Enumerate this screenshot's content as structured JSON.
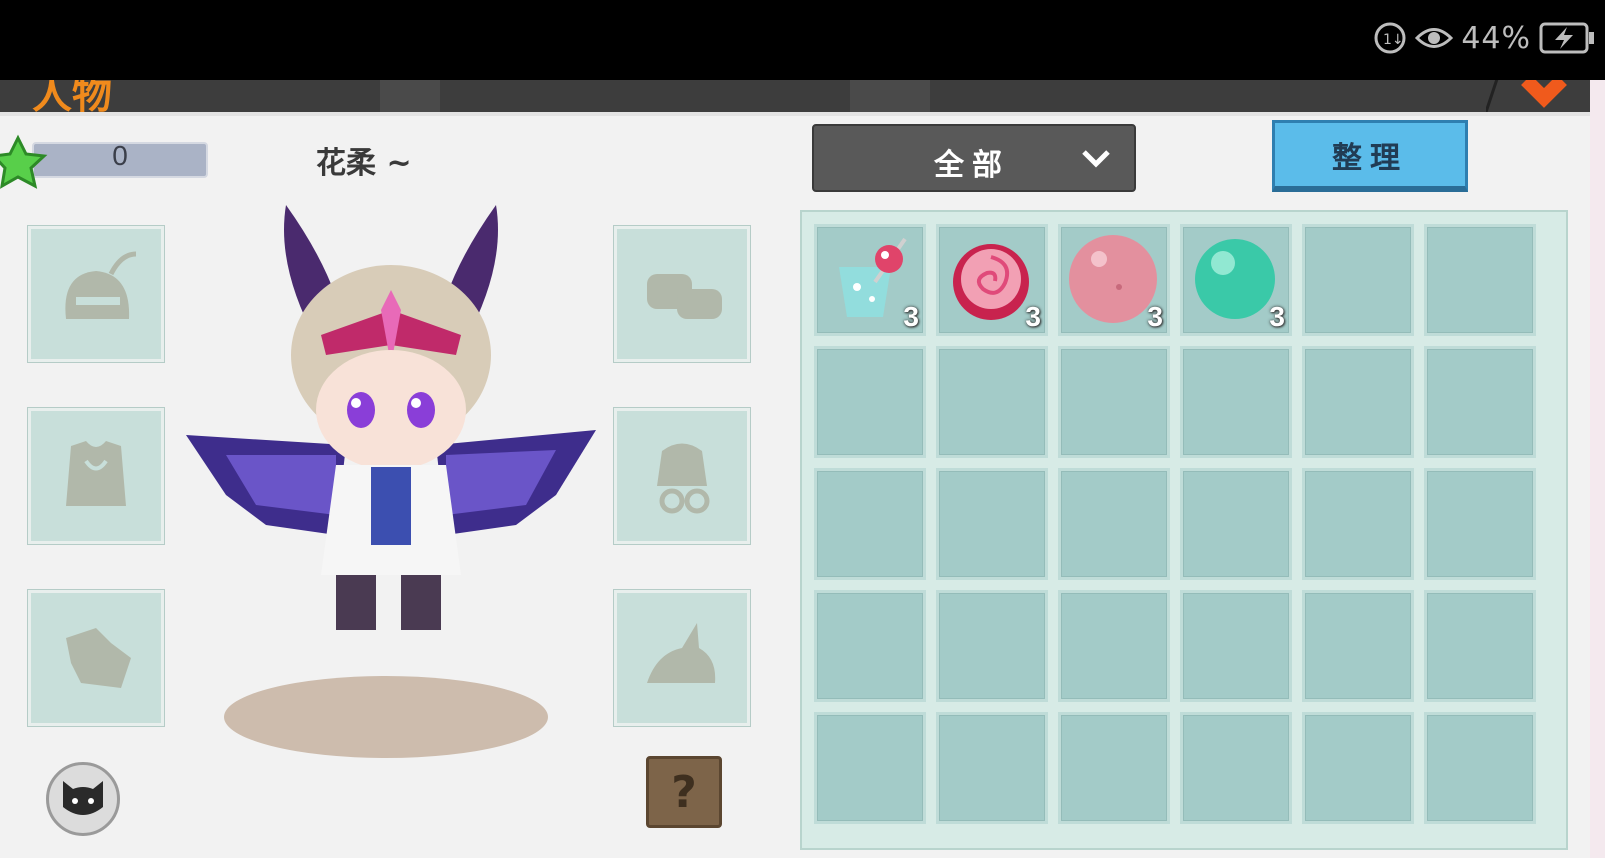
{
  "status_bar": {
    "battery_percent": "44%",
    "icons": [
      "data-saver-icon",
      "eye-comfort-icon",
      "battery-charging-icon"
    ]
  },
  "header": {
    "title": "人物"
  },
  "profile": {
    "level": "0",
    "name": "花柔 ~"
  },
  "equipment": {
    "left_slots": [
      "helmet-icon",
      "armor-icon",
      "shoes-icon"
    ],
    "right_slots": [
      "gloves-icon",
      "face-accessory-icon",
      "pet-mount-icon"
    ]
  },
  "inventory": {
    "filter_label": "全部",
    "sort_label": "整理",
    "columns": 6,
    "rows": 5,
    "items": [
      {
        "icon": "drink-cup-icon",
        "count": "3"
      },
      {
        "icon": "red-candy-icon",
        "count": "3"
      },
      {
        "icon": "pink-ball-icon",
        "count": "3"
      },
      {
        "icon": "green-bubble-icon",
        "count": "3"
      }
    ]
  },
  "colors": {
    "accent_blue": "#5bbcea",
    "slot_teal": "#a3cbc8",
    "header_orange": "#f08a1c"
  }
}
